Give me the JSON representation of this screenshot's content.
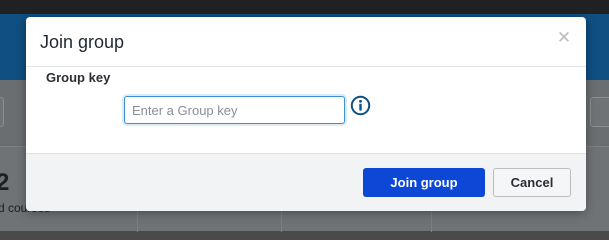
{
  "background": {
    "stats": [
      {
        "number": "2",
        "label": "d courses"
      },
      {
        "number": "",
        "label": ""
      },
      {
        "number": "",
        "label": ""
      },
      {
        "number": "",
        "label": ""
      }
    ]
  },
  "modal": {
    "title": "Join group",
    "close_icon": "close-icon",
    "field": {
      "label": "Group key",
      "value": "",
      "placeholder": "Enter a Group key",
      "info_icon": "info-icon"
    },
    "buttons": {
      "join_label": "Join group",
      "cancel_label": "Cancel"
    }
  },
  "colors": {
    "primary_button": "#0c47d6",
    "input_focus_border": "#3c8fd6",
    "info_icon": "#0f4f82",
    "header_bg": "#0f4f82"
  }
}
